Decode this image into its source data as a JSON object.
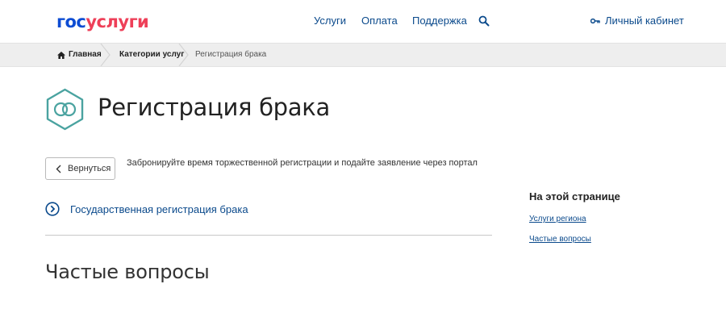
{
  "header": {
    "logo_part1": "гос",
    "logo_part2": "услуги",
    "nav": [
      "Услуги",
      "Оплата",
      "Поддержка"
    ],
    "cabinet_label": "Личный кабинет"
  },
  "breadcrumbs": {
    "home": "Главная",
    "categories": "Категории услуг",
    "current": "Регистрация брака"
  },
  "main": {
    "title": "Регистрация брака",
    "back_label": "Вернуться",
    "description": "Забронируйте время торжественной регистрации и подайте заявление через портал",
    "service_link": "Государственная регистрация брака",
    "faq_heading": "Частые вопросы"
  },
  "sidebar": {
    "title": "На этой странице",
    "links": [
      "Услуги региона",
      "Частые вопросы"
    ]
  },
  "icons": {
    "title_icon": "rings-icon",
    "service_icon": "chevron-circle-icon",
    "search": "search-icon",
    "cabinet": "key-icon",
    "home": "home-icon",
    "back": "chevron-left-icon"
  },
  "colors": {
    "brand_blue": "#0d4cd3",
    "brand_red": "#ee3f58",
    "link": "#0b4a8c",
    "accent_teal": "#4aa3a0"
  }
}
